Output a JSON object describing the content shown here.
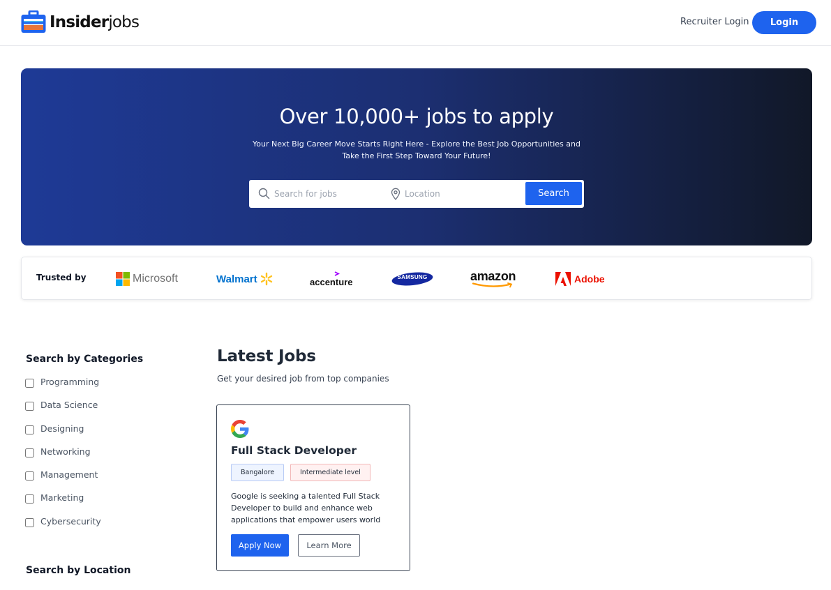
{
  "header": {
    "logo_bold": "Insider",
    "logo_light": "jobs",
    "logo_icon": "briefcase-icon",
    "recruiter_login": "Recruiter Login",
    "login": "Login"
  },
  "hero": {
    "title": "Over 10,000+ jobs to apply",
    "subtitle_line1": "Your Next Big Career Move Starts Right Here - Explore the Best Job Opportunities and",
    "subtitle_line2": "Take the First Step Toward Your Future!",
    "search_placeholder": "Search for jobs",
    "location_placeholder": "Location",
    "search_button": "Search"
  },
  "trusted": {
    "label": "Trusted by",
    "brands": [
      "Microsoft",
      "Walmart",
      "accenture",
      "SAMSUNG",
      "amazon",
      "Adobe"
    ]
  },
  "sidebar": {
    "categories_heading": "Search by Categories",
    "categories": [
      "Programming",
      "Data Science",
      "Designing",
      "Networking",
      "Management",
      "Marketing",
      "Cybersecurity"
    ],
    "location_heading": "Search by Location"
  },
  "jobs": {
    "title": "Latest Jobs",
    "subtitle": "Get your desired job from top companies",
    "cards": [
      {
        "company_icon": "google-logo-icon",
        "title": "Full Stack Developer",
        "location": "Bangalore",
        "level": "Intermediate level",
        "description": "Google is seeking a talented Full Stack Developer to build and enhance web applications that empower users world",
        "apply_label": "Apply Now",
        "learn_label": "Learn More"
      }
    ]
  },
  "colors": {
    "accent": "#1e63ee",
    "hero_gradient_start": "#1e3a96",
    "hero_gradient_end": "#111828"
  }
}
